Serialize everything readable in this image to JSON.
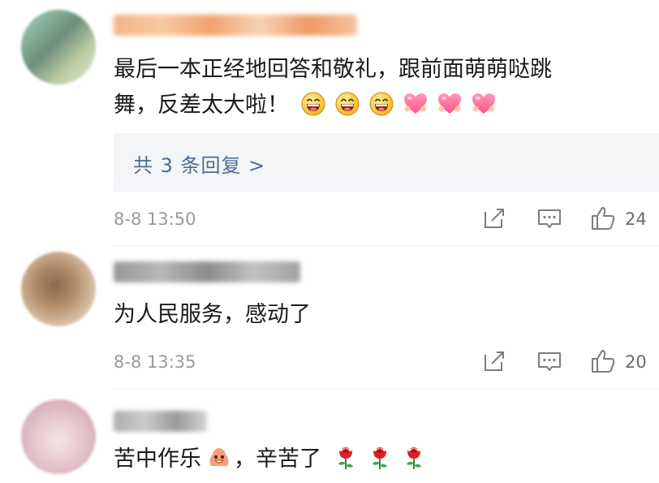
{
  "comments": [
    {
      "text_line1": "最后一本正经地回答和敬礼，跟前面萌萌哒跳",
      "text_line2": "舞，反差太大啦！",
      "replies_label": "共 3 条回复 >",
      "time": "8-8 13:50",
      "likes": "24"
    },
    {
      "text": "为人民服务，感动了",
      "time": "8-8 13:35",
      "likes": "20"
    },
    {
      "text": "苦中作乐",
      "text_after": "，辛苦了"
    }
  ],
  "icons": [
    "share-icon",
    "comment-icon",
    "like-icon",
    "grin-emoji",
    "heart-emoji",
    "rose-emoji",
    "mascot-emoji"
  ],
  "colors": {
    "link": "#4b6c94",
    "time": "#9a9a9a",
    "reply_bg": "#f4f5f7",
    "text": "#1a1a1a"
  }
}
